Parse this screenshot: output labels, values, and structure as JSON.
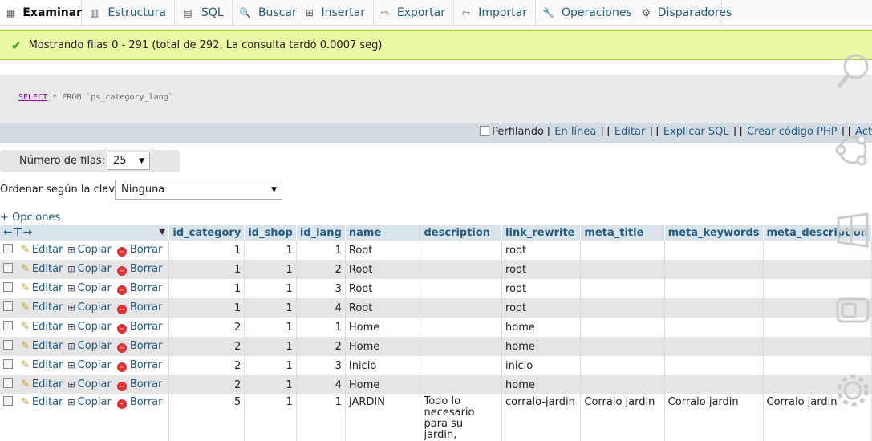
{
  "tabs": [
    {
      "label": "Examinar",
      "icon": "browse-icon",
      "active": true
    },
    {
      "label": "Estructura",
      "icon": "structure-icon"
    },
    {
      "label": "SQL",
      "icon": "sql-icon"
    },
    {
      "label": "Buscar",
      "icon": "search-icon"
    },
    {
      "label": "Insertar",
      "icon": "insert-icon"
    },
    {
      "label": "Exportar",
      "icon": "export-icon"
    },
    {
      "label": "Importar",
      "icon": "import-icon"
    },
    {
      "label": "Operaciones",
      "icon": "wrench-icon"
    },
    {
      "label": "Disparadores",
      "icon": "triggers-icon"
    }
  ],
  "message": "Mostrando filas 0 - 291 (total de 292, La consulta tardó 0.0007 seg)",
  "query": {
    "keyword": "SELECT",
    "rest": " * FROM `ps_category_lang`"
  },
  "links": {
    "profiling": "Perfilando",
    "inline": "En línea",
    "edit": "Editar",
    "explain": "Explicar SQL",
    "php": "Crear código PHP",
    "refresh": "Actualizar"
  },
  "rows_label": "Número de filas:",
  "rows_value": "25",
  "order_label": "Ordenar según la clave:",
  "order_value": "Ninguna",
  "options_label": "+ Opciones",
  "columns": [
    "id_category",
    "id_shop",
    "id_lang",
    "name",
    "description",
    "link_rewrite",
    "meta_title",
    "meta_keywords",
    "meta_description"
  ],
  "actions": {
    "edit": "Editar",
    "copy": "Copiar",
    "delete": "Borrar"
  },
  "rows": [
    [
      "1",
      "1",
      "1",
      "Root",
      "",
      "root",
      "",
      "",
      ""
    ],
    [
      "1",
      "1",
      "2",
      "Root",
      "",
      "root",
      "",
      "",
      ""
    ],
    [
      "1",
      "1",
      "3",
      "Root",
      "",
      "root",
      "",
      "",
      ""
    ],
    [
      "1",
      "1",
      "4",
      "Root",
      "",
      "root",
      "",
      "",
      ""
    ],
    [
      "2",
      "1",
      "1",
      "Home",
      "",
      "home",
      "",
      "",
      ""
    ],
    [
      "2",
      "1",
      "2",
      "Home",
      "",
      "home",
      "",
      "",
      ""
    ],
    [
      "2",
      "1",
      "3",
      "Inicio",
      "",
      "inicio",
      "",
      "",
      ""
    ],
    [
      "2",
      "1",
      "4",
      "Home",
      "",
      "home",
      "",
      "",
      ""
    ],
    [
      "5",
      "1",
      "1",
      "JARDIN",
      "Todo lo necesario para su jardin,",
      "corralo-jardin",
      "Corralo jardin",
      "Corralo jardin",
      "Corralo jardin"
    ]
  ]
}
